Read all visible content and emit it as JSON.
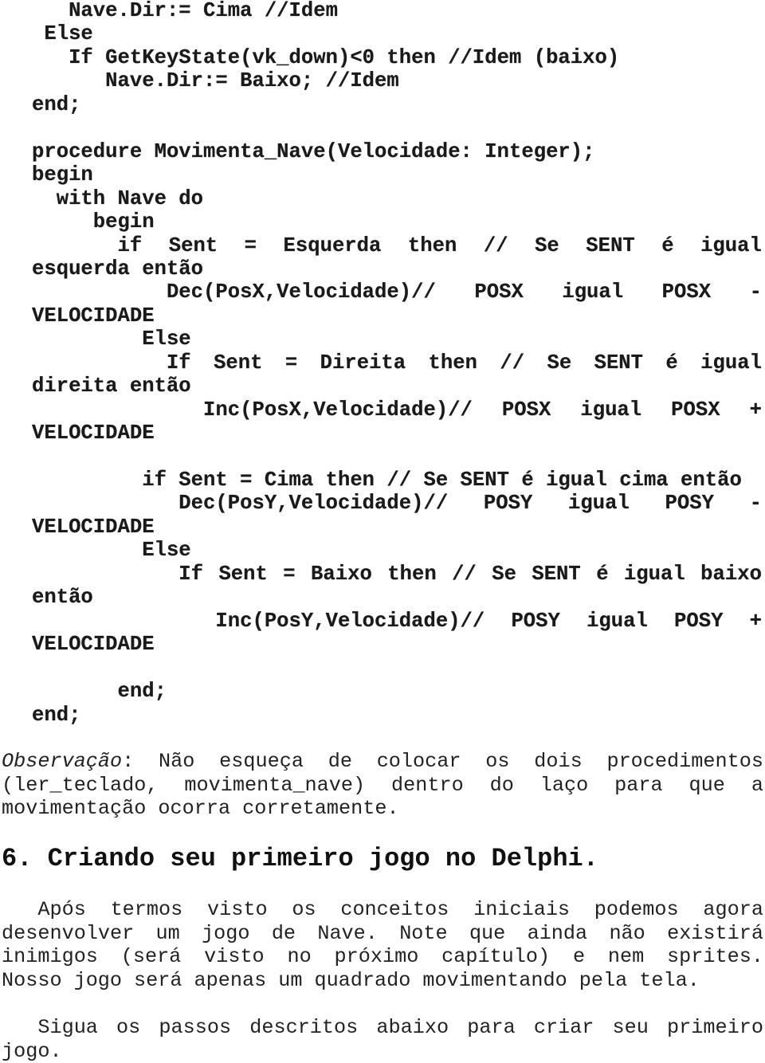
{
  "code": {
    "lines": [
      {
        "indent": "   ",
        "text": "Nave.Dir:= Cima //Idem"
      },
      {
        "indent": " ",
        "text": "Else"
      },
      {
        "indent": "   ",
        "text": "If GetKeyState(vk_down)<0 then //Idem (baixo)"
      },
      {
        "indent": "      ",
        "text": "Nave.Dir:= Baixo; //Idem"
      },
      {
        "indent": "",
        "text": "end;"
      },
      {
        "indent": "",
        "text": ""
      },
      {
        "indent": "",
        "text": "procedure Movimenta_Nave(Velocidade: Integer);"
      },
      {
        "indent": "",
        "text": "begin"
      },
      {
        "indent": "  ",
        "text": "with Nave do"
      },
      {
        "indent": "     ",
        "text": "begin"
      },
      {
        "indent": "       ",
        "text": "if Sent = Esquerda then // Se SENT é igual",
        "justify": true
      },
      {
        "indent": "",
        "text": "esquerda então"
      },
      {
        "indent": "           ",
        "text": "Dec(PosX,Velocidade)// POSX igual POSX -",
        "justify": true
      },
      {
        "indent": "",
        "text": "VELOCIDADE"
      },
      {
        "indent": "         ",
        "text": "Else"
      },
      {
        "indent": "           ",
        "text": "If Sent = Direita then // Se SENT é igual",
        "justify": true
      },
      {
        "indent": "",
        "text": "direita então"
      },
      {
        "indent": "              ",
        "text": "Inc(PosX,Velocidade)// POSX igual POSX +",
        "justify": true
      },
      {
        "indent": "",
        "text": "VELOCIDADE"
      },
      {
        "indent": "",
        "text": ""
      },
      {
        "indent": "         ",
        "text": "if Sent = Cima then // Se SENT é igual cima então"
      },
      {
        "indent": "            ",
        "text": "Dec(PosY,Velocidade)// POSY igual POSY -",
        "justify": true
      },
      {
        "indent": "",
        "text": "VELOCIDADE"
      },
      {
        "indent": "         ",
        "text": "Else"
      },
      {
        "indent": "            ",
        "text": "If Sent = Baixo then // Se SENT é igual baixo",
        "justify": true
      },
      {
        "indent": "",
        "text": "então"
      },
      {
        "indent": "               ",
        "text": "Inc(PosY,Velocidade)// POSY igual POSY +",
        "justify": true
      },
      {
        "indent": "",
        "text": "VELOCIDADE"
      },
      {
        "indent": "",
        "text": ""
      },
      {
        "indent": "       ",
        "text": "end;"
      },
      {
        "indent": "",
        "text": "end;"
      }
    ]
  },
  "observation": {
    "label": "Observação",
    "lines": [
      ": Não esqueça de colocar os dois procedimentos",
      "(ler_teclado, movimenta_nave) dentro do laço para que a",
      "movimentação ocorra corretamente."
    ]
  },
  "section_heading": "6. Criando seu primeiro jogo no Delphi.",
  "paragraph1": {
    "lines": [
      "   Após termos visto os conceitos iniciais podemos agora",
      "desenvolver um jogo de Nave. Note que ainda não existirá",
      "inimigos (será visto no próximo capítulo) e nem sprites.",
      "Nosso jogo será apenas um quadrado movimentando pela tela."
    ]
  },
  "paragraph2": {
    "lines": [
      "   Sigua os passos descritos abaixo para criar seu primeiro",
      "jogo."
    ]
  }
}
